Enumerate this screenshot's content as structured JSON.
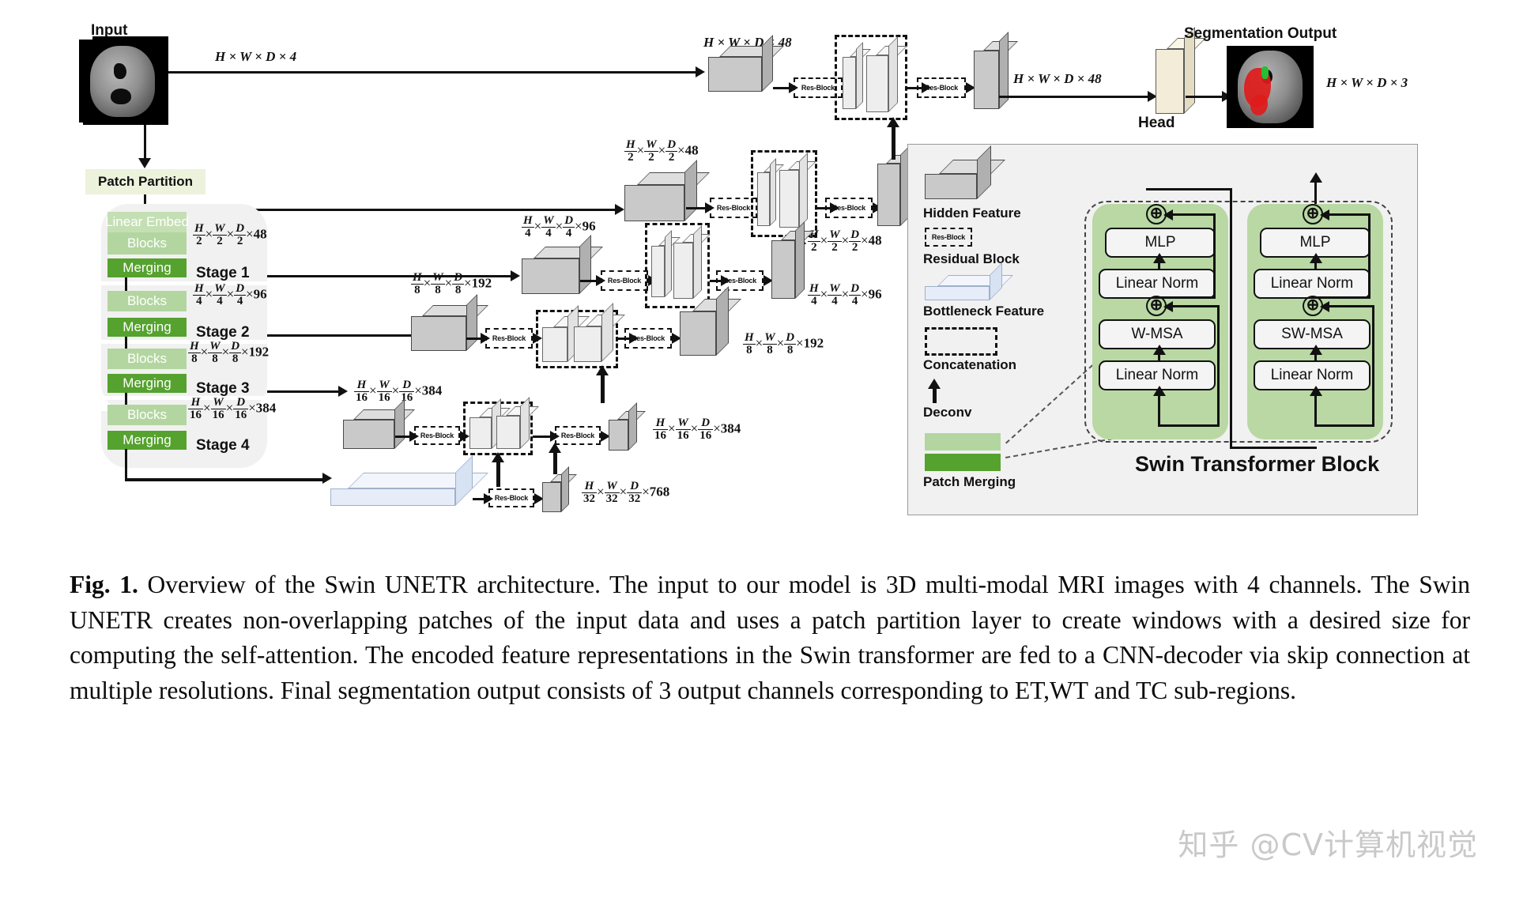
{
  "figure": {
    "input_label": "Input",
    "input_dim": "H × W × D × 4",
    "patch_partition": "Patch Partition",
    "head_label": "Head",
    "segmentation_output_label": "Segmentation Output",
    "output_dim": "H × W × D × 3",
    "top_feature_dim": "H × W × D × 48",
    "post_head_dim": "H × W × D × 48",
    "res_block_label": "Res-Block"
  },
  "encoder": {
    "linear_embed": "Linear Embed",
    "stages": [
      {
        "blocks": "Blocks",
        "merging": "Merging",
        "label": "Stage 1",
        "dim_num": [
          "H",
          "W",
          "D"
        ],
        "dim_den": [
          "2",
          "2",
          "2"
        ],
        "channels": "48"
      },
      {
        "blocks": "Blocks",
        "merging": "Merging",
        "label": "Stage 2",
        "dim_num": [
          "H",
          "W",
          "D"
        ],
        "dim_den": [
          "4",
          "4",
          "4"
        ],
        "channels": "96"
      },
      {
        "blocks": "Blocks",
        "merging": "Merging",
        "label": "Stage 3",
        "dim_num": [
          "H",
          "W",
          "D"
        ],
        "dim_den": [
          "8",
          "8",
          "8"
        ],
        "channels": "192"
      },
      {
        "blocks": "Blocks",
        "merging": "Merging",
        "label": "Stage 4",
        "dim_num": [
          "H",
          "W",
          "D"
        ],
        "dim_den": [
          "16",
          "16",
          "16"
        ],
        "channels": "384"
      }
    ]
  },
  "decoder_rows": [
    {
      "left_dim_den": "2",
      "left_channels": "48",
      "right_dim_den": "2",
      "right_channels": "48"
    },
    {
      "left_dim_den": "4",
      "left_channels": "96",
      "right_dim_den": "4",
      "right_channels": "96"
    },
    {
      "left_dim_den": "8",
      "left_channels": "192",
      "right_dim_den": "8",
      "right_channels": "192"
    },
    {
      "left_dim_den": "16",
      "left_channels": "384",
      "right_dim_den": "16",
      "right_channels": "384"
    },
    {
      "left_dim_den": "32",
      "left_channels": "768",
      "right_dim_den": "32",
      "right_channels": "768"
    }
  ],
  "legend": {
    "items": [
      {
        "name": "hidden-feature",
        "label": "Hidden Feature"
      },
      {
        "name": "residual-block",
        "label": "Residual Block",
        "inner": "Res-Block"
      },
      {
        "name": "bottleneck-feature",
        "label": "Bottleneck Feature"
      },
      {
        "name": "concatenation",
        "label": "Concatenation"
      },
      {
        "name": "deconv",
        "label": "Deconv"
      },
      {
        "name": "patch-merging",
        "label": "Patch Merging"
      }
    ]
  },
  "swin": {
    "title": "Swin Transformer Block",
    "columns": [
      {
        "mlp": "MLP",
        "norm_top": "Linear Norm",
        "attn": "W-MSA",
        "norm_bottom": "Linear Norm"
      },
      {
        "mlp": "MLP",
        "norm_top": "Linear Norm",
        "attn": "SW-MSA",
        "norm_bottom": "Linear Norm"
      }
    ],
    "plus_symbol": "⊕"
  },
  "caption": {
    "prefix": "Fig. 1.",
    "text": " Overview of the Swin UNETR architecture. The input to our model is 3D multi-modal MRI images with 4 channels. The Swin UNETR creates non-overlapping patches of the input data and uses a patch partition layer to create windows with a desired size for computing the self-attention. The encoded feature representations in the Swin transformer are fed to a CNN-decoder via skip connection at multiple resolutions. Final segmentation output consists of 3 output channels corresponding to ET,WT and TC sub-regions."
  },
  "watermark": {
    "text": "知乎 @CV计算机视觉"
  },
  "colors": {
    "stage_block_light": "#b3d6a0",
    "stage_merging_dark": "#55a22e",
    "patch_partition_bg": "#edf2dd",
    "panel_bg": "#f1f1f1",
    "hidden_feature": "#c9c9c9",
    "bottleneck_feature": "#e6edf8",
    "segmentation_red": "#e01b1b",
    "segmentation_green": "#22c032"
  }
}
